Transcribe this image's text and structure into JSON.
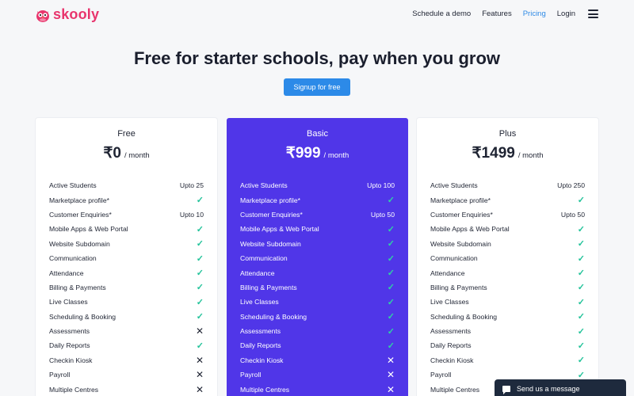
{
  "brand": {
    "name": "skooly",
    "color": "#e8356d"
  },
  "nav": {
    "items": [
      {
        "label": "Schedule a demo",
        "active": false
      },
      {
        "label": "Features",
        "active": false
      },
      {
        "label": "Pricing",
        "active": true
      },
      {
        "label": "Login",
        "active": false
      }
    ],
    "menu_icon": "hamburger-icon"
  },
  "hero": {
    "title": "Free for starter schools, pay when you grow",
    "cta_label": "Signup for free"
  },
  "plans": [
    {
      "name": "Free",
      "price": "₹0",
      "period": "/ month",
      "features": [
        {
          "label": "Active Students",
          "value": "Upto 25"
        },
        {
          "label": "Marketplace profile*",
          "value": "check"
        },
        {
          "label": "Customer Enquiries*",
          "value": "Upto 10"
        },
        {
          "label": "Mobile Apps & Web Portal",
          "value": "check"
        },
        {
          "label": "Website Subdomain",
          "value": "check"
        },
        {
          "label": "Communication",
          "value": "check"
        },
        {
          "label": "Attendance",
          "value": "check"
        },
        {
          "label": "Billing & Payments",
          "value": "check"
        },
        {
          "label": "Live Classes",
          "value": "check"
        },
        {
          "label": "Scheduling & Booking",
          "value": "check"
        },
        {
          "label": "Assessments",
          "value": "cross"
        },
        {
          "label": "Daily Reports",
          "value": "check"
        },
        {
          "label": "Checkin Kiosk",
          "value": "cross"
        },
        {
          "label": "Payroll",
          "value": "cross"
        },
        {
          "label": "Multiple Centres",
          "value": "cross"
        }
      ]
    },
    {
      "name": "Basic",
      "price": "₹999",
      "period": "/ month",
      "features": [
        {
          "label": "Active Students",
          "value": "Upto 100"
        },
        {
          "label": "Marketplace profile*",
          "value": "check"
        },
        {
          "label": "Customer Enquiries*",
          "value": "Upto 50"
        },
        {
          "label": "Mobile Apps & Web Portal",
          "value": "check"
        },
        {
          "label": "Website Subdomain",
          "value": "check"
        },
        {
          "label": "Communication",
          "value": "check"
        },
        {
          "label": "Attendance",
          "value": "check"
        },
        {
          "label": "Billing & Payments",
          "value": "check"
        },
        {
          "label": "Live Classes",
          "value": "check"
        },
        {
          "label": "Scheduling & Booking",
          "value": "check"
        },
        {
          "label": "Assessments",
          "value": "check"
        },
        {
          "label": "Daily Reports",
          "value": "check"
        },
        {
          "label": "Checkin Kiosk",
          "value": "cross"
        },
        {
          "label": "Payroll",
          "value": "cross"
        },
        {
          "label": "Multiple Centres",
          "value": "cross"
        }
      ]
    },
    {
      "name": "Plus",
      "price": "₹1499",
      "period": "/ month",
      "features": [
        {
          "label": "Active Students",
          "value": "Upto 250"
        },
        {
          "label": "Marketplace profile*",
          "value": "check"
        },
        {
          "label": "Customer Enquiries*",
          "value": "Upto 50"
        },
        {
          "label": "Mobile Apps & Web Portal",
          "value": "check"
        },
        {
          "label": "Website Subdomain",
          "value": "check"
        },
        {
          "label": "Communication",
          "value": "check"
        },
        {
          "label": "Attendance",
          "value": "check"
        },
        {
          "label": "Billing & Payments",
          "value": "check"
        },
        {
          "label": "Live Classes",
          "value": "check"
        },
        {
          "label": "Scheduling & Booking",
          "value": "check"
        },
        {
          "label": "Assessments",
          "value": "check"
        },
        {
          "label": "Daily Reports",
          "value": "check"
        },
        {
          "label": "Checkin Kiosk",
          "value": "check"
        },
        {
          "label": "Payroll",
          "value": "check"
        },
        {
          "label": "Multiple Centres",
          "value": "check"
        }
      ]
    }
  ],
  "chat_widget": {
    "label": "Send us a message",
    "icon": "chat-bubble-icon"
  },
  "colors": {
    "accent": "#2c8ae8",
    "highlight_card": "#5036e8",
    "check": "#23c39a",
    "page_bg": "#f6f7f9"
  }
}
